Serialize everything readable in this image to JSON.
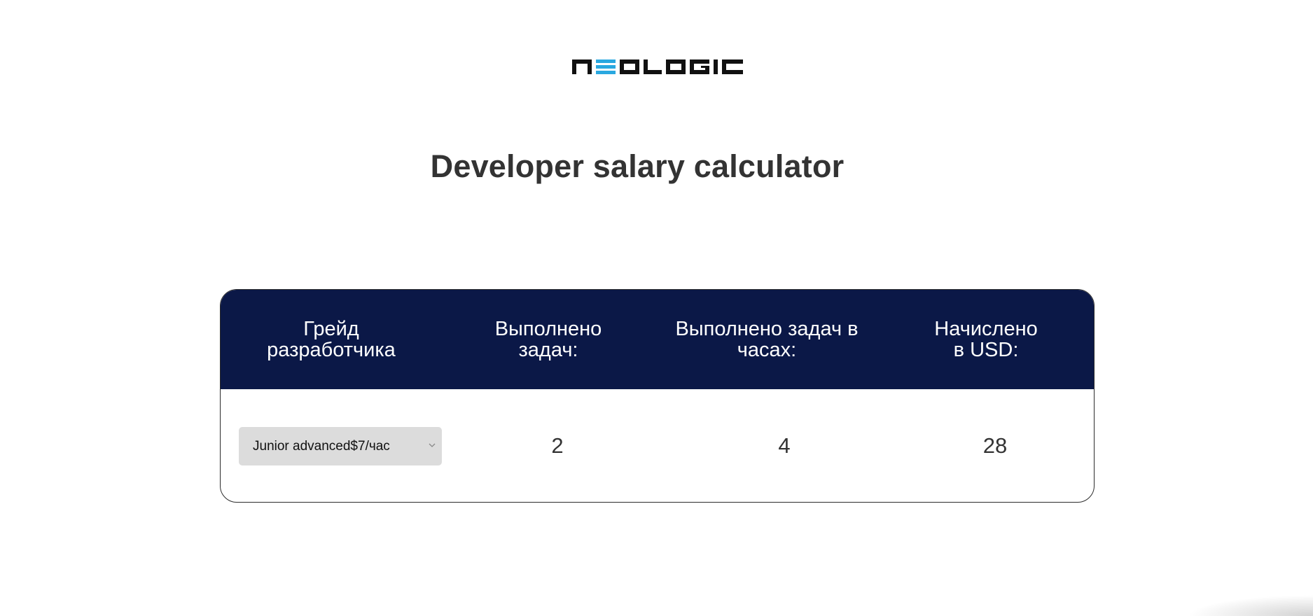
{
  "logo": {
    "text": "NEOLOGIC",
    "colors": {
      "dark": "#111111",
      "accent": "#2aa8e0"
    }
  },
  "page_title": "Developer salary calculator",
  "table": {
    "headers": [
      {
        "line1": "Грейд",
        "line2": "разработчика"
      },
      {
        "line1": "Выполнено",
        "line2": "задач:"
      },
      {
        "line1": "Выполнено задач в",
        "line2": "часах:"
      },
      {
        "line1": "Начислено",
        "line2": "в USD:"
      }
    ],
    "row": {
      "grade_select_value": "Junior advanced$7/час",
      "tasks_done": "2",
      "hours": "4",
      "usd": "28"
    },
    "header_bg": "#0b1847"
  }
}
